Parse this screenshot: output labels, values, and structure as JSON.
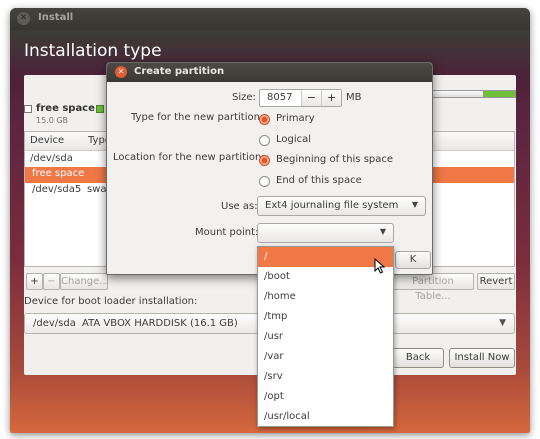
{
  "window": {
    "title": "Install",
    "heading": "Installation type"
  },
  "legend": {
    "free_space_label": "free space",
    "free_space_size": "15.0 GB"
  },
  "table": {
    "headers": [
      "Device",
      "Type"
    ],
    "rows": [
      {
        "device": "/dev/sda",
        "type": ""
      },
      {
        "device": "free space",
        "type": ""
      },
      {
        "device": "/dev/sda5",
        "type": "swap"
      }
    ]
  },
  "toolbar": {
    "add": "+",
    "remove": "−",
    "change": "Change...",
    "new_table": "Partition Table...",
    "revert": "Revert"
  },
  "boot_loader": {
    "label": "Device for boot loader installation:",
    "device": "/dev/sda",
    "description": "ATA VBOX HARDDISK (16.1 GB)"
  },
  "nav": {
    "back": "Back",
    "install": "Install Now"
  },
  "dialog": {
    "title": "Create partition",
    "size_label": "Size:",
    "size_value": "8057",
    "size_unit": "MB",
    "minus": "−",
    "plus": "+",
    "type_label": "Type for the new partition:",
    "type_primary": "Primary",
    "type_logical": "Logical",
    "location_label": "Location for the new partition:",
    "location_beginning": "Beginning of this space",
    "location_end": "End of this space",
    "useas_label": "Use as:",
    "useas_value": "Ext4 journaling file system",
    "mount_label": "Mount point:",
    "mount_value": "",
    "ok_label": "OK",
    "ok_visible": "K"
  },
  "mount_options": [
    "/",
    "/boot",
    "/home",
    "/tmp",
    "/usr",
    "/var",
    "/srv",
    "/opt",
    "/usr/local"
  ],
  "colors": {
    "accent": "#f07746",
    "radio_selected": "#e0552a",
    "disk_used": "#6fbf3a"
  }
}
